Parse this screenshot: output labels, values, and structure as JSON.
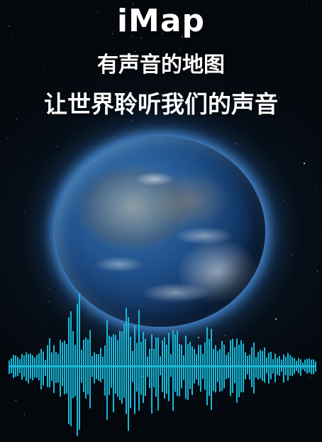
{
  "poster": {
    "title": "iMap",
    "tagline_1": "有声音的地图",
    "tagline_2": "让世界聆听我们的声音"
  },
  "colors": {
    "background": "#050a10",
    "glow": "#5aaaff",
    "waveform": "#18b8d8",
    "text": "#ffffff"
  },
  "icons": {
    "globe": "earth-globe-image",
    "waveform": "sound-wave-graphic"
  }
}
